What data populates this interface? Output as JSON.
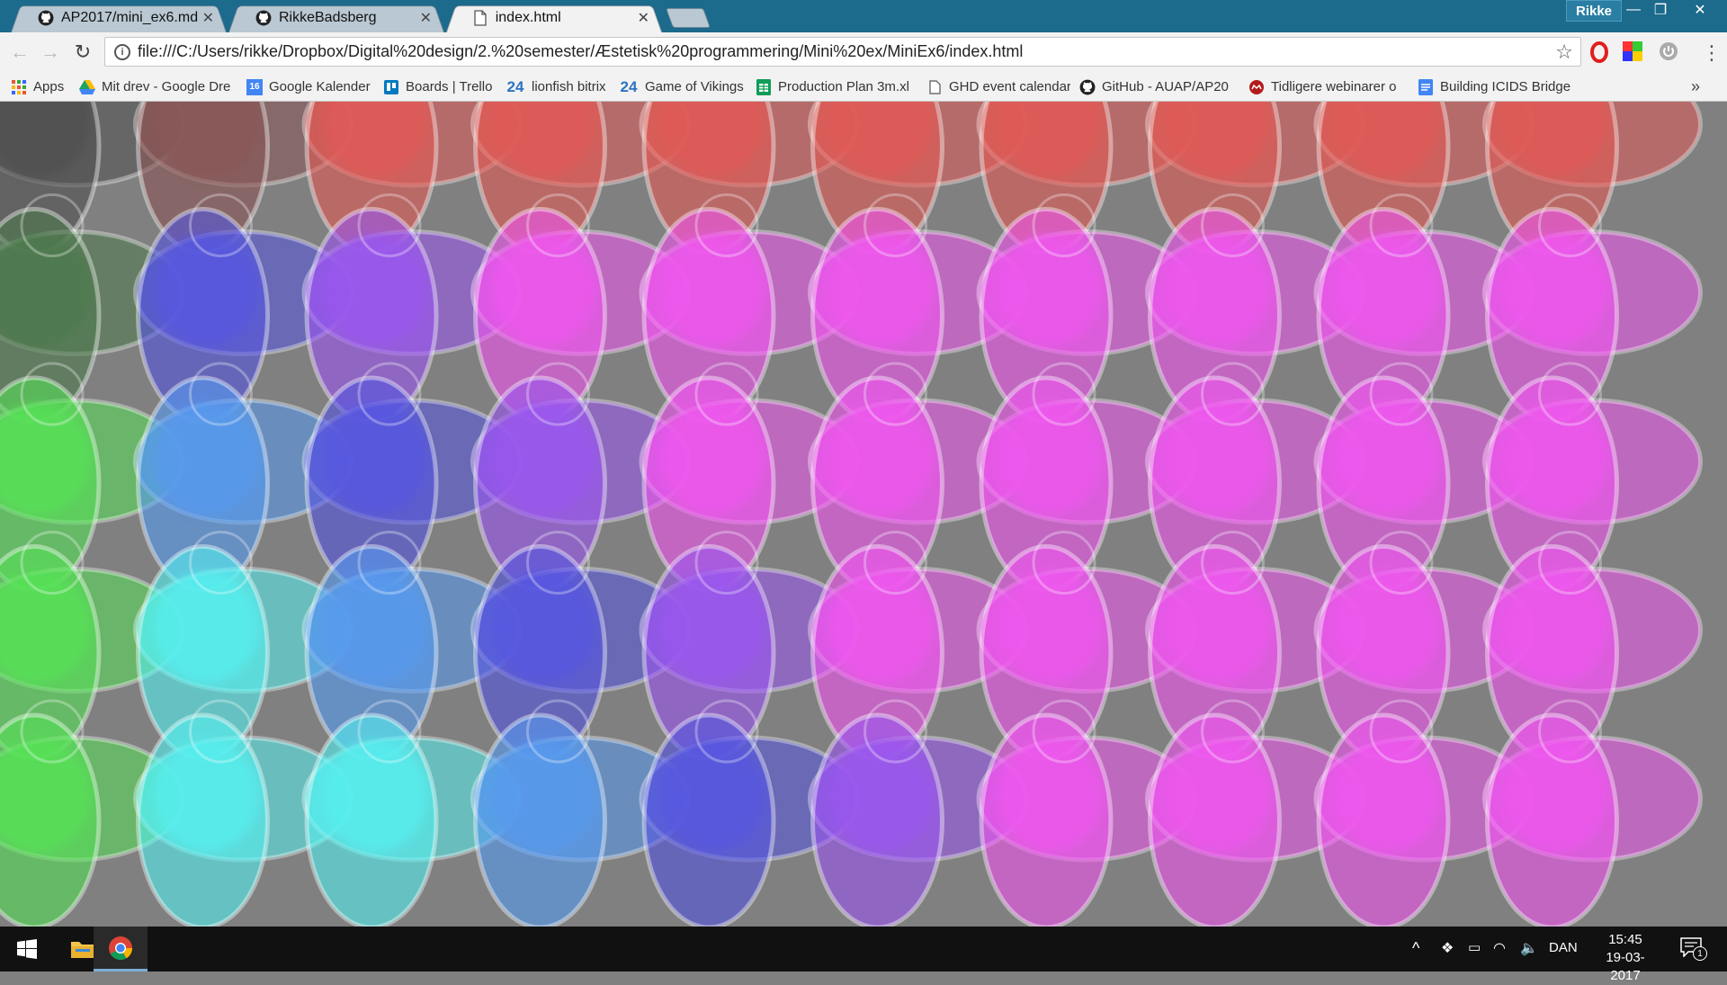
{
  "browser": {
    "tabs": [
      {
        "title": "AP2017/mini_ex6.md at r",
        "icon": "github-icon",
        "active": false
      },
      {
        "title": "RikkeBadsberg",
        "icon": "github-icon",
        "active": false
      },
      {
        "title": "index.html",
        "icon": "file-icon",
        "active": true
      }
    ],
    "profile_name": "Rikke",
    "window_controls": {
      "minimize": "—",
      "restore": "❐",
      "close": "✕"
    },
    "address_bar": {
      "url": "file:///C:/Users/rikke/Dropbox/Digital%20design/2.%20semester/Æstetisk%20programmering/Mini%20ex/MiniEx6/index.html"
    },
    "bookmarks": [
      {
        "label": "Apps",
        "icon": "apps-grid-icon",
        "color": "#333"
      },
      {
        "label": "Mit drev - Google Dre",
        "icon": "google-drive-icon",
        "color": "#333"
      },
      {
        "label": "Google Kalender",
        "icon": "calendar-icon",
        "color": "#333"
      },
      {
        "label": "Boards | Trello",
        "icon": "trello-icon",
        "color": "#333"
      },
      {
        "label": "lionfish bitrix",
        "icon": "bitrix24-icon",
        "badge": "24",
        "color": "#333"
      },
      {
        "label": "Game of Vikings",
        "icon": "bitrix24-icon",
        "badge": "24",
        "color": "#333"
      },
      {
        "label": "Production Plan 3m.xl",
        "icon": "sheets-icon",
        "color": "#333"
      },
      {
        "label": "GHD event calendar",
        "icon": "page-icon",
        "color": "#333"
      },
      {
        "label": "GitHub - AUAP/AP20",
        "icon": "github-icon",
        "color": "#333"
      },
      {
        "label": "Tidligere webinarer o",
        "icon": "webinar-icon",
        "color": "#333"
      },
      {
        "label": "Building ICIDS Bridge",
        "icon": "docs-icon",
        "color": "#333"
      }
    ]
  },
  "canvas": {
    "background": "#808080",
    "grid": [
      [
        "gray",
        "red-gray",
        "red",
        "red",
        "red",
        "red",
        "red",
        "red",
        "red",
        "red"
      ],
      [
        "green-gray",
        "blue",
        "purple",
        "magenta",
        "magenta",
        "magenta",
        "magenta",
        "magenta",
        "magenta",
        "magenta"
      ],
      [
        "green",
        "light-blue",
        "blue",
        "purple",
        "magenta",
        "magenta",
        "magenta",
        "magenta",
        "magenta",
        "magenta"
      ],
      [
        "green",
        "cyan",
        "light-blue",
        "blue",
        "purple",
        "magenta",
        "magenta",
        "magenta",
        "magenta",
        "magenta"
      ],
      [
        "green",
        "cyan",
        "cyan",
        "light-blue",
        "blue",
        "purple",
        "magenta",
        "magenta",
        "magenta",
        "magenta"
      ]
    ],
    "palette": {
      "gray": "#505050",
      "red-gray": "#8a5555",
      "red": "#e05a55",
      "green-gray": "#4e7a4e",
      "green": "#55e055",
      "blue": "#5555e0",
      "purple": "#9955ee",
      "magenta": "#ee55ee",
      "light-blue": "#5599ee",
      "cyan": "#55eeee"
    }
  },
  "taskbar": {
    "apps": [
      {
        "name": "start-button",
        "icon": "windows-logo-icon"
      },
      {
        "name": "file-explorer",
        "icon": "folder-icon"
      },
      {
        "name": "chrome",
        "icon": "chrome-icon",
        "active": true
      }
    ],
    "language": "DAN",
    "time": "15:45",
    "date": "19-03-2017",
    "notification_count": "1"
  }
}
